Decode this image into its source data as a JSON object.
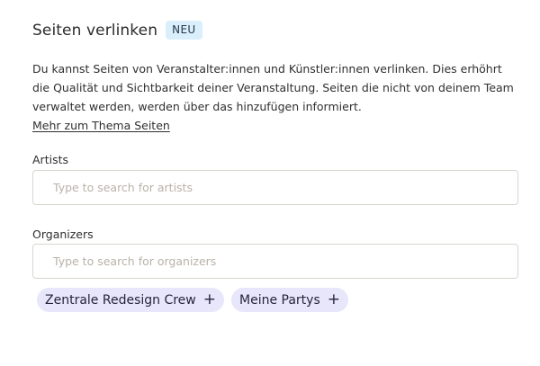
{
  "header": {
    "title": "Seiten verlinken",
    "badge": "NEU"
  },
  "description": {
    "text": "Du kannst Seiten von Veranstalter:innen und Künstler:innen verlinken. Dies erhöhrt die Qualität und Sichtbarkeit deiner Veranstaltung. Seiten die nicht von deinem Team verwaltet werden, werden über das hinzufügen informiert.",
    "link": "Mehr zum Thema Seiten"
  },
  "artists": {
    "label": "Artists",
    "placeholder": "Type to search for artists",
    "value": ""
  },
  "organizers": {
    "label": "Organizers",
    "placeholder": "Type to search for organizers",
    "value": "",
    "suggestions": [
      {
        "label": "Zentrale Redesign Crew",
        "icon": "plus-icon"
      },
      {
        "label": "Meine Partys",
        "icon": "plus-icon"
      }
    ]
  }
}
